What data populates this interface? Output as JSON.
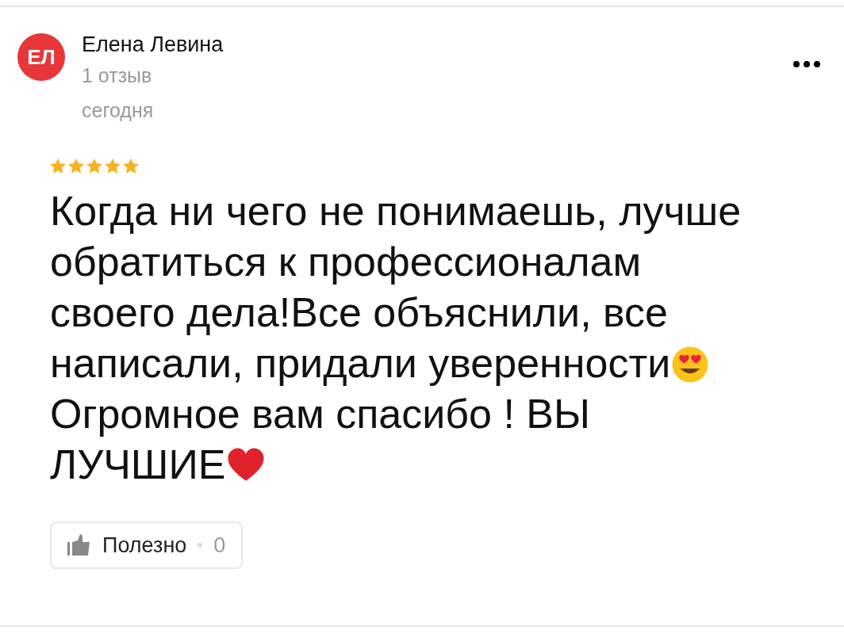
{
  "review": {
    "initials": "ЕЛ",
    "author": "Елена Левина",
    "review_count": "1 отзыв",
    "date": "сегодня",
    "stars": 5,
    "body": [
      {
        "kind": "plain",
        "text": "Когда ни чего не понимаешь, лучше"
      },
      {
        "kind": "plain",
        "text": "обратиться к профессионалам"
      },
      {
        "kind": "plain",
        "text": "своего дела!Все объяснили, все"
      },
      {
        "kind": "smiley",
        "text": "написали, придали уверенности"
      },
      {
        "kind": "plain",
        "text": "Огромное вам спасибо ! ВЫ"
      },
      {
        "kind": "heart",
        "text": "ЛУЧШИЕ"
      }
    ],
    "helpful": {
      "label": "Полезно",
      "count": "0"
    }
  }
}
